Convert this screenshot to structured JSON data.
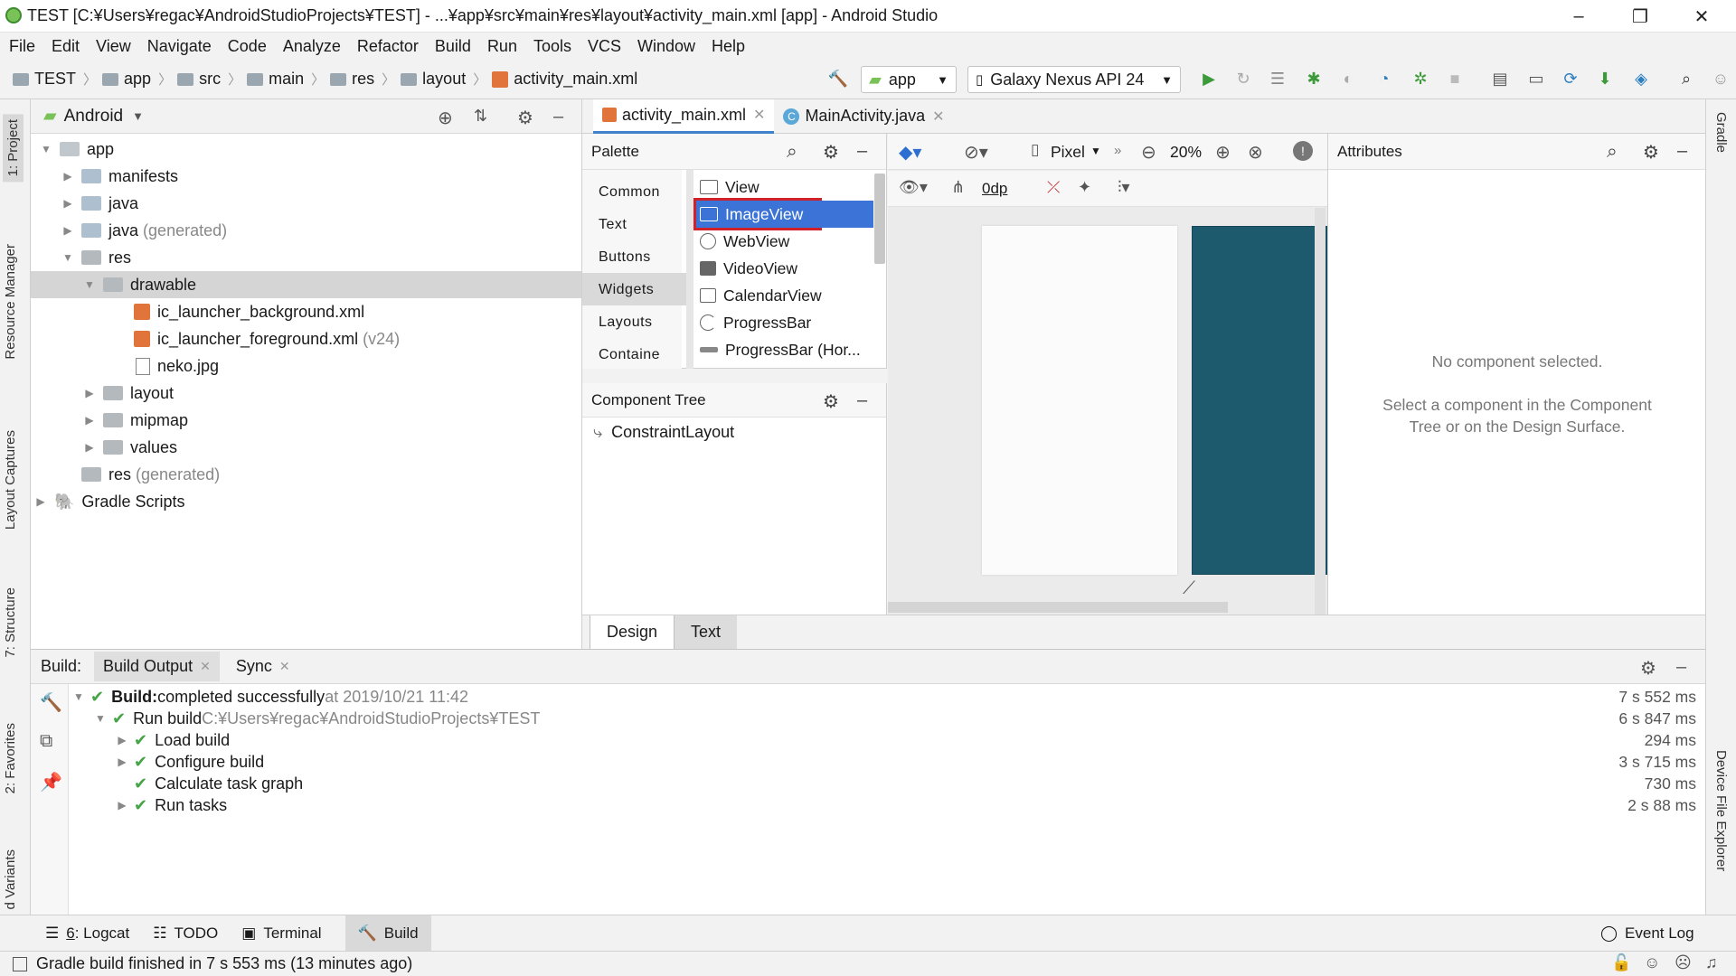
{
  "title": "TEST [C:¥Users¥regac¥AndroidStudioProjects¥TEST] - ...¥app¥src¥main¥res¥layout¥activity_main.xml [app] - Android Studio",
  "menu": [
    "File",
    "Edit",
    "View",
    "Navigate",
    "Code",
    "Analyze",
    "Refactor",
    "Build",
    "Run",
    "Tools",
    "VCS",
    "Window",
    "Help"
  ],
  "breadcrumbs": [
    "TEST",
    "app",
    "src",
    "main",
    "res",
    "layout",
    "activity_main.xml"
  ],
  "run_config": "app",
  "device": "Galaxy Nexus API 24",
  "project": {
    "view_label": "Android",
    "tree": [
      {
        "label": "app",
        "secondary": ""
      },
      {
        "label": "manifests",
        "secondary": ""
      },
      {
        "label": "java",
        "secondary": ""
      },
      {
        "label": "java",
        "secondary": "(generated)"
      },
      {
        "label": "res",
        "secondary": ""
      },
      {
        "label": "drawable",
        "secondary": ""
      },
      {
        "label": "ic_launcher_background.xml",
        "secondary": ""
      },
      {
        "label": "ic_launcher_foreground.xml",
        "secondary": "(v24)"
      },
      {
        "label": "neko.jpg",
        "secondary": ""
      },
      {
        "label": "layout",
        "secondary": ""
      },
      {
        "label": "mipmap",
        "secondary": ""
      },
      {
        "label": "values",
        "secondary": ""
      },
      {
        "label": "res",
        "secondary": "(generated)"
      },
      {
        "label": "Gradle Scripts",
        "secondary": ""
      }
    ]
  },
  "editor_tabs": [
    "activity_main.xml",
    "MainActivity.java"
  ],
  "palette": {
    "title": "Palette",
    "categories": [
      "Common",
      "Text",
      "Buttons",
      "Widgets",
      "Layouts",
      "Containe"
    ],
    "items": [
      "View",
      "ImageView",
      "WebView",
      "VideoView",
      "CalendarView",
      "ProgressBar",
      "ProgressBar (Hor..."
    ]
  },
  "component_tree": {
    "title": "Component Tree",
    "root": "ConstraintLayout"
  },
  "design_toolbar": {
    "device": "Pixel",
    "zoom": "20%",
    "margin": "0dp"
  },
  "attributes": {
    "title": "Attributes",
    "empty": "No component selected.",
    "hint_line1": "Select a component in the Component",
    "hint_line2": "Tree or on the Design Surface."
  },
  "design_tabs": [
    "Design",
    "Text"
  ],
  "build": {
    "label": "Build:",
    "tabs": [
      "Build Output",
      "Sync"
    ],
    "rows": [
      {
        "bold": "Build:",
        "text": " completed successfully",
        "meta": " at 2019/10/21 11:42",
        "time": "7 s 552 ms"
      },
      {
        "bold": "",
        "text": "Run build",
        "meta": " C:¥Users¥regac¥AndroidStudioProjects¥TEST",
        "time": "6 s 847 ms"
      },
      {
        "bold": "",
        "text": "Load build",
        "meta": "",
        "time": "294 ms"
      },
      {
        "bold": "",
        "text": "Configure build",
        "meta": "",
        "time": "3 s 715 ms"
      },
      {
        "bold": "",
        "text": "Calculate task graph",
        "meta": "",
        "time": "730 ms"
      },
      {
        "bold": "",
        "text": "Run tasks",
        "meta": "",
        "time": "2 s 88 ms"
      }
    ]
  },
  "left_tabs": [
    "1: Project",
    "Resource Manager",
    "Layout Captures",
    "7: Structure",
    "2: Favorites",
    "d Variants"
  ],
  "right_tabs": [
    "Gradle",
    "Device File Explorer"
  ],
  "bottom_tools": [
    {
      "underline": "6",
      "rest": ": Logcat"
    },
    {
      "underline": "",
      "rest": "TODO"
    },
    {
      "underline": "",
      "rest": "Terminal"
    },
    {
      "underline": "",
      "rest": "Build"
    }
  ],
  "event_log": "Event Log",
  "status": "Gradle build finished in 7 s 553 ms (13 minutes ago)",
  "colors": {
    "selection": "#3b73d6",
    "canvas": "#1e5a6e",
    "highlight_box": "#d0202a",
    "success": "#46a447"
  }
}
